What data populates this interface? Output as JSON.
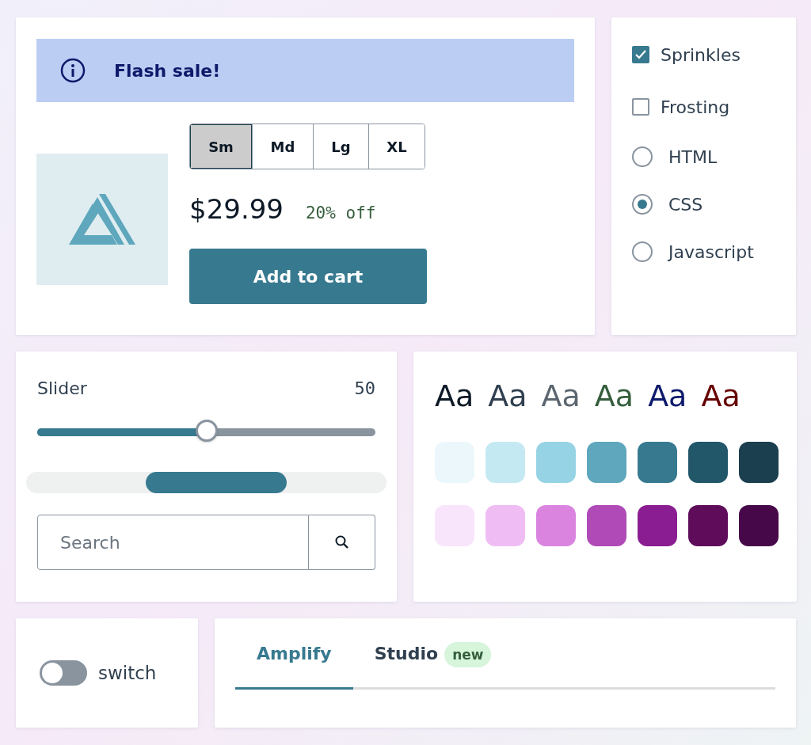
{
  "alert": {
    "text": "Flash sale!"
  },
  "sizes": [
    {
      "label": "Sm",
      "selected": true
    },
    {
      "label": "Md",
      "selected": false
    },
    {
      "label": "Lg",
      "selected": false
    },
    {
      "label": "XL",
      "selected": false
    }
  ],
  "price": "$29.99",
  "discount": "20% off",
  "cart_button": "Add to cart",
  "options": [
    {
      "kind": "checkbox",
      "label": "Sprinkles",
      "checked": true
    },
    {
      "kind": "checkbox",
      "label": "Frosting",
      "checked": false
    },
    {
      "kind": "radio",
      "label": "HTML",
      "selected": false
    },
    {
      "kind": "radio",
      "label": "CSS",
      "selected": true
    },
    {
      "kind": "radio",
      "label": "Javascript",
      "selected": false
    }
  ],
  "slider": {
    "label": "Slider",
    "reading": "50",
    "level": 0.5
  },
  "search": {
    "placeholder": "Search"
  },
  "type_samples": [
    {
      "text": "Aa",
      "color": "#0d1926"
    },
    {
      "text": "Aa",
      "color": "#304050"
    },
    {
      "text": "Aa",
      "color": "#5c6670"
    },
    {
      "text": "Aa",
      "color": "#365e3d"
    },
    {
      "text": "Aa",
      "color": "#0d1a6b"
    },
    {
      "text": "Aa",
      "color": "#660000"
    }
  ],
  "swatches": [
    {
      "color": "#ebf7fb"
    },
    {
      "color": "#c5e9f2"
    },
    {
      "color": "#96d4e5"
    },
    {
      "color": "#5ea7bd"
    },
    {
      "color": "#377a90"
    },
    {
      "color": "#22576a"
    },
    {
      "color": "#1b3f4e"
    },
    {
      "color": "#f9e5fb"
    },
    {
      "color": "#efbdf4"
    },
    {
      "color": "#da84e0"
    },
    {
      "color": "#b04ab6"
    },
    {
      "color": "#8a1d91"
    },
    {
      "color": "#5f0d5b"
    },
    {
      "color": "#47084a"
    }
  ],
  "switch": {
    "label": "switch",
    "on": false
  },
  "tabs": [
    {
      "label": "Amplify",
      "selected": true
    },
    {
      "label": "Studio",
      "badge": "new",
      "selected": false
    }
  ]
}
